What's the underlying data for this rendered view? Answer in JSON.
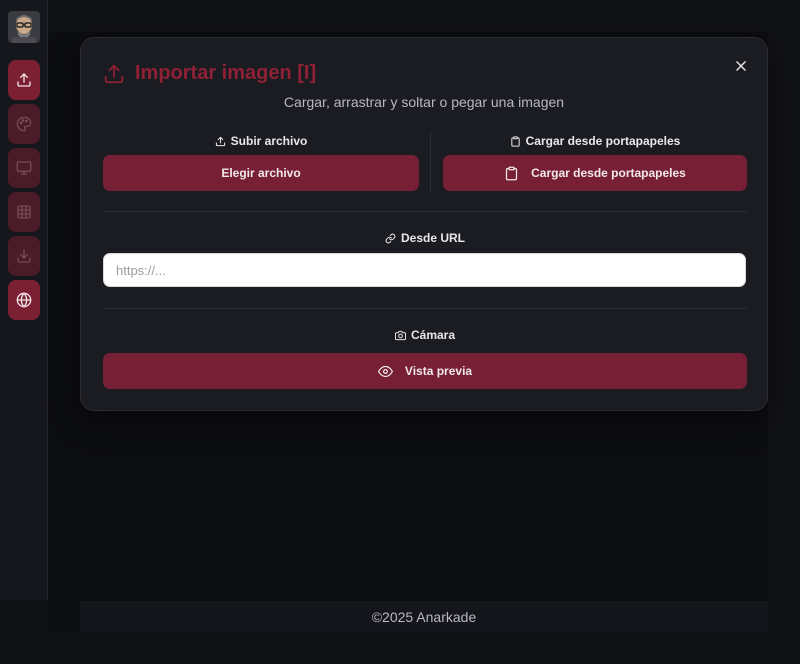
{
  "sidebar": {
    "items": [
      {
        "icon": "upload-icon",
        "active": true
      },
      {
        "icon": "palette-icon",
        "active": false
      },
      {
        "icon": "monitor-icon",
        "active": false
      },
      {
        "icon": "grid-icon",
        "active": false
      },
      {
        "icon": "download-icon",
        "active": false
      },
      {
        "icon": "globe-icon",
        "active": true
      }
    ]
  },
  "modal": {
    "title": "Importar imagen [I]",
    "subtitle": "Cargar, arrastrar y soltar o pegar una imagen",
    "upload": {
      "label": "Subir archivo",
      "button": "Elegir archivo"
    },
    "clipboard": {
      "label": "Cargar desde portapapeles",
      "button": "Cargar desde portapapeles"
    },
    "url": {
      "label": "Desde URL",
      "placeholder": "https://...",
      "value": ""
    },
    "camera": {
      "label": "Cámara",
      "button": "Vista previa"
    }
  },
  "footer": {
    "text": "©2025 Anarkade"
  },
  "colors": {
    "accent": "#761f35",
    "title": "#8e2136",
    "modal_bg": "#1b1c21",
    "page_bg": "#0c0d11"
  }
}
